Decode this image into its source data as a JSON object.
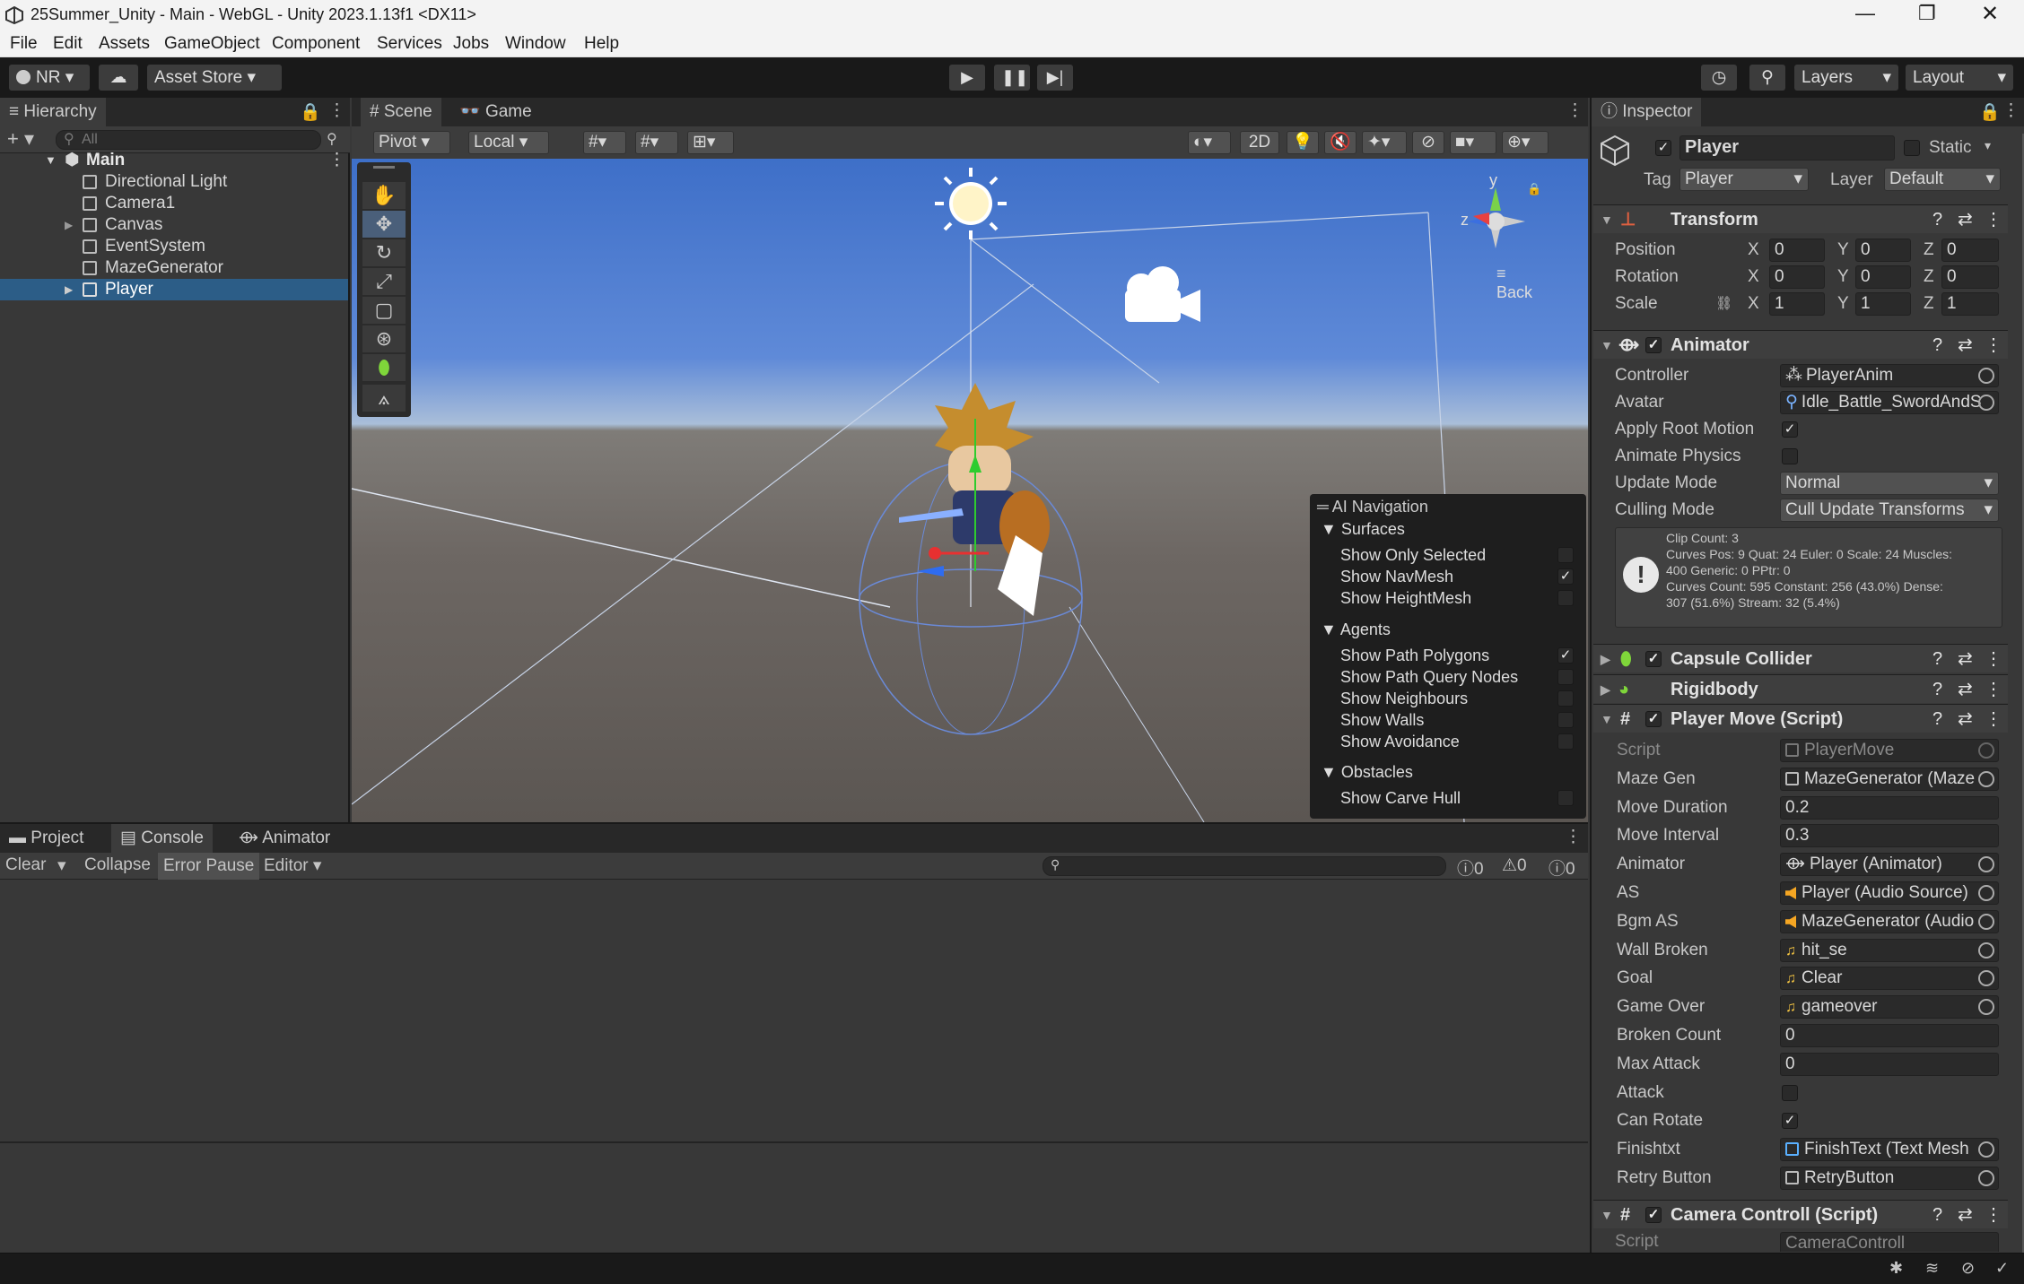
{
  "window": {
    "title": "25Summer_Unity - Main - WebGL - Unity 2023.1.13f1 <DX11>",
    "controls": [
      "—",
      "❐",
      "✕"
    ]
  },
  "menu": [
    "File",
    "Edit",
    "Assets",
    "GameObject",
    "Component",
    "Services",
    "Jobs",
    "Window",
    "Help"
  ],
  "toolbar": {
    "account": "NR",
    "asset_store": "Asset Store",
    "layers": "Layers",
    "layout": "Layout"
  },
  "hierarchy": {
    "tab": "Hierarchy",
    "search_placeholder": "All",
    "scene": "Main",
    "items": [
      "Directional Light",
      "Camera1",
      "Canvas",
      "EventSystem",
      "MazeGenerator",
      "Player"
    ],
    "selected": "Player"
  },
  "scene_view": {
    "tabs": [
      "Scene",
      "Game"
    ],
    "pivot": "Pivot",
    "local": "Local",
    "mode_2d": "2D",
    "back_label": "Back",
    "gizmo_y": "y",
    "gizmo_z": "z"
  },
  "ai_navigation": {
    "title": "AI Navigation",
    "sections": [
      {
        "name": "Surfaces",
        "items": [
          {
            "label": "Show Only Selected",
            "checked": false
          },
          {
            "label": "Show NavMesh",
            "checked": true
          },
          {
            "label": "Show HeightMesh",
            "checked": false
          }
        ]
      },
      {
        "name": "Agents",
        "items": [
          {
            "label": "Show Path Polygons",
            "checked": true
          },
          {
            "label": "Show Path Query Nodes",
            "checked": false
          },
          {
            "label": "Show Neighbours",
            "checked": false
          },
          {
            "label": "Show Walls",
            "checked": false
          },
          {
            "label": "Show Avoidance",
            "checked": false
          }
        ]
      },
      {
        "name": "Obstacles",
        "items": [
          {
            "label": "Show Carve Hull",
            "checked": false
          }
        ]
      }
    ]
  },
  "console": {
    "tabs": [
      "Project",
      "Console",
      "Animator"
    ],
    "buttons": [
      "Clear",
      "Collapse",
      "Error Pause",
      "Editor"
    ],
    "counts": {
      "info": "0",
      "warn": "0",
      "error": "0"
    }
  },
  "inspector": {
    "tab": "Inspector",
    "object_name": "Player",
    "static": "Static",
    "tag_label": "Tag",
    "tag": "Player",
    "layer_label": "Layer",
    "layer": "Default",
    "transform": {
      "title": "Transform",
      "rows": [
        {
          "label": "Position",
          "x": "0",
          "y": "0",
          "z": "0"
        },
        {
          "label": "Rotation",
          "x": "0",
          "y": "0",
          "z": "0"
        },
        {
          "label": "Scale",
          "x": "1",
          "y": "1",
          "z": "1"
        }
      ]
    },
    "animator": {
      "title": "Animator",
      "controller_label": "Controller",
      "controller": "PlayerAnim",
      "avatar_label": "Avatar",
      "avatar": "Idle_Battle_SwordAndS",
      "apply_root_label": "Apply Root Motion",
      "animate_physics_label": "Animate Physics",
      "update_mode_label": "Update Mode",
      "update_mode": "Normal",
      "culling_label": "Culling Mode",
      "culling": "Cull Update Transforms",
      "info_lines": [
        "Clip Count: 3",
        "Curves Pos: 9 Quat: 24 Euler: 0 Scale: 24 Muscles:",
        "400 Generic: 0 PPtr: 0",
        "Curves Count: 595 Constant: 256 (43.0%) Dense:",
        "307 (51.6%) Stream: 32 (5.4%)"
      ]
    },
    "capsule": "Capsule Collider",
    "rigidbody": "Rigidbody",
    "player_move": {
      "title": "Player Move (Script)",
      "rows": [
        {
          "label": "Script",
          "value": "PlayerMove",
          "kind": "script"
        },
        {
          "label": "Maze Gen",
          "value": "MazeGenerator (Maze",
          "kind": "obj"
        },
        {
          "label": "Move Duration",
          "value": "0.2",
          "kind": "text"
        },
        {
          "label": "Move Interval",
          "value": "0.3",
          "kind": "text"
        },
        {
          "label": "Animator",
          "value": "Player (Animator)",
          "kind": "anim"
        },
        {
          "label": "AS",
          "value": "Player (Audio Source)",
          "kind": "audio"
        },
        {
          "label": "Bgm AS",
          "value": "MazeGenerator (Audio",
          "kind": "audio"
        },
        {
          "label": "Wall Broken",
          "value": "hit_se",
          "kind": "note"
        },
        {
          "label": "Goal",
          "value": "Clear",
          "kind": "note"
        },
        {
          "label": "Game Over",
          "value": "gameover",
          "kind": "note"
        },
        {
          "label": "Broken Count",
          "value": "0",
          "kind": "text"
        },
        {
          "label": "Max Attack",
          "value": "0",
          "kind": "text"
        },
        {
          "label": "Attack",
          "value": "",
          "kind": "check-off"
        },
        {
          "label": "Can Rotate",
          "value": "",
          "kind": "check-on"
        },
        {
          "label": "Finishtxt",
          "value": "FinishText (Text Mesh",
          "kind": "text-obj"
        },
        {
          "label": "Retry Button",
          "value": "RetryButton",
          "kind": "obj"
        }
      ]
    },
    "camera_controll": {
      "title": "Camera Controll (Script)",
      "script_label": "Script",
      "script_value": "CameraControll"
    }
  }
}
